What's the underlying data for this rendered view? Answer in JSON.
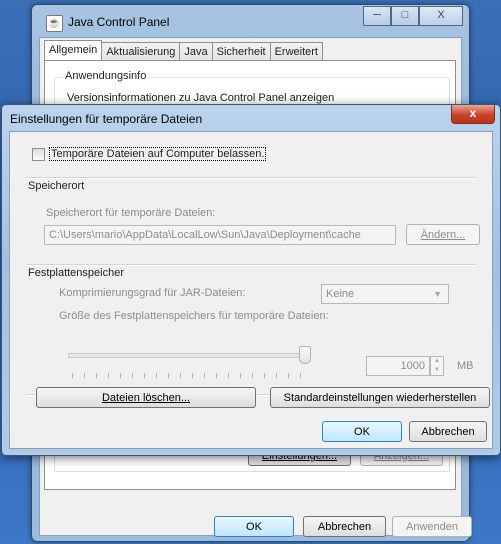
{
  "desktop": {
    "bg": "#3b6fb6"
  },
  "jcp": {
    "title": "Java Control Panel",
    "window_buttons": {
      "minimize": "─",
      "maximize": "□",
      "close": "X"
    },
    "tabs": [
      {
        "label": "Allgemein",
        "active": true
      },
      {
        "label": "Aktualisierung",
        "active": false
      },
      {
        "label": "Java",
        "active": false
      },
      {
        "label": "Sicherheit",
        "active": false
      },
      {
        "label": "Erweitert",
        "active": false
      }
    ],
    "group_title": "Anwendungsinfo",
    "group_text": "Versionsinformationen zu Java Control Panel anzeigen",
    "buttons": {
      "settings": "Einstellungen...",
      "view": "Anzeigen...",
      "ok": "OK",
      "cancel": "Abbrechen",
      "apply": "Anwenden"
    }
  },
  "dialog": {
    "title": "Einstellungen für temporäre Dateien",
    "close": "x",
    "keep_checkbox": {
      "label": "Temporäre Dateien auf Computer belassen.",
      "checked": false
    },
    "location": {
      "section": "Speicherort",
      "label": "Speicherort für temporäre Dateien:",
      "path": "C:\\Users\\mario\\AppData\\LocalLow\\Sun\\Java\\Deployment\\cache",
      "change_button": "Ändern..."
    },
    "disk": {
      "section": "Festplattenspeicher",
      "compression_label": "Komprimierungsgrad für JAR-Dateien:",
      "compression_value": "Keine",
      "size_label": "Größe des Festplattenspeichers für temporäre Dateien:",
      "size_value": "1000",
      "size_unit": "MB",
      "slider_fraction": 1.0
    },
    "buttons": {
      "delete_files": "Dateien löschen...",
      "restore_defaults": "Standardeinstellungen wiederherstellen",
      "ok": "OK",
      "cancel": "Abbrechen"
    }
  }
}
